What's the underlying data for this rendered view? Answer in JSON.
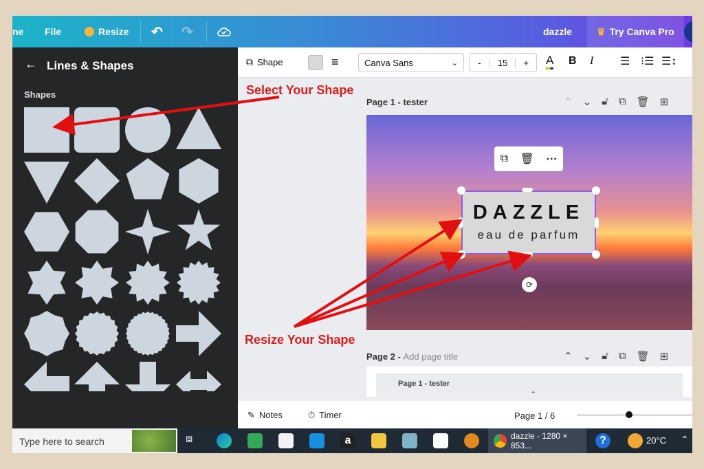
{
  "topbar": {
    "home_partial": "ne",
    "file": "File",
    "resize": "Resize",
    "doc_name": "dazzle",
    "try_pro": "Try Canva Pro"
  },
  "left_panel": {
    "title": "Lines & Shapes",
    "section": "Shapes",
    "shapes": [
      "square",
      "rounded-square",
      "circle",
      "triangle",
      "inverted-triangle",
      "diamond",
      "pentagon",
      "hexagon",
      "hexagon-flat",
      "octagon",
      "4-point-star",
      "5-point-star",
      "6-point-star",
      "8-point-star",
      "12-point-star",
      "16-point-star",
      "scalloped-octagon",
      "scalloped-circle",
      "serrated-circle",
      "arrow-right",
      "arrow-left",
      "arrow-up",
      "arrow-down",
      "arrow-left-right"
    ]
  },
  "toolbar": {
    "shape_label": "Shape",
    "fill_color": "#d9d9d9",
    "font": "Canva Sans",
    "font_size": "15",
    "minus": "-",
    "plus": "+",
    "bold": "B",
    "italic": "I",
    "text_color_letter": "A"
  },
  "canvas": {
    "page1_title": "Page 1 - tester",
    "page2_prefix": "Page 2 - ",
    "page2_placeholder": "Add page title",
    "nested_page_title": "Page 1 - tester",
    "design_title": "DAZZLE",
    "design_subtitle": "eau de parfum"
  },
  "annotations": {
    "select": "Select Your Shape",
    "resize": "Resize Your Shape",
    "color": "#d91e1e"
  },
  "bottombar": {
    "notes": "Notes",
    "timer": "Timer",
    "page_indicator": "Page 1 / 6",
    "zoom_fraction": 0.45
  },
  "taskbar": {
    "search_placeholder": "Type here to search",
    "active_window": "dazzle - 1280 × 853...",
    "weather": "20°C"
  }
}
